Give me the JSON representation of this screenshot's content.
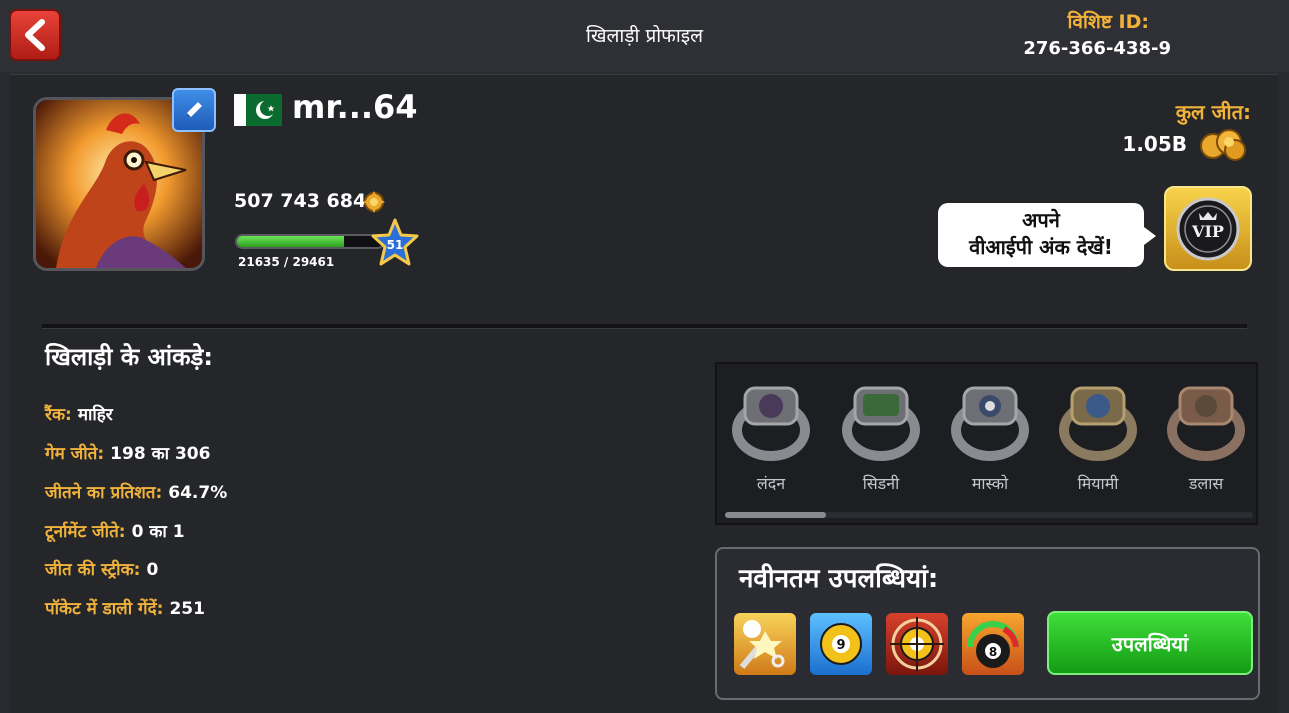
{
  "header": {
    "back_icon": "chevron-left-icon",
    "title": "खिलाड़ी प्रोफाइल",
    "unique_id_label": "विशिष्ट ID:",
    "unique_id_value": "276-366-438-9"
  },
  "profile": {
    "username": "mr...64",
    "flag": "pakistan-flag",
    "coins": "507 743 684",
    "xp_text": "21635 / 29461",
    "xp_fraction": 0.734,
    "level": "51",
    "total_wins_label": "कुल जीत:",
    "total_wins_value": "1.05B"
  },
  "vip": {
    "line1": "अपने",
    "line2": "वीआईपी अंक देखें!",
    "badge_text": "VIP"
  },
  "stats": {
    "title": "खिलाड़ी के आंकड़े:",
    "items": [
      {
        "label": "रैंक:",
        "value": "माहिर"
      },
      {
        "label": "गेम जीते:",
        "value": "198 का 306"
      },
      {
        "label": "जीतने का प्रतिशत:",
        "value": "64.7%"
      },
      {
        "label": "टूर्नामेंट जीते:",
        "value": "0 का 1"
      },
      {
        "label": "जीत की स्ट्रीक:",
        "value": "0"
      },
      {
        "label": "पॉकेट में डाली गेंदें:",
        "value": "251"
      }
    ]
  },
  "rings": [
    {
      "label": "लंदन"
    },
    {
      "label": "सिडनी"
    },
    {
      "label": "मास्को"
    },
    {
      "label": "मियामी"
    },
    {
      "label": "डलास"
    }
  ],
  "achievements": {
    "title": "नवीनतम उपलब्धियां:",
    "button_label": "उपलब्धियां",
    "icons": [
      "cue-ball-break-icon",
      "nine-ball-icon",
      "target-nine-ball-icon",
      "eight-ball-gauge-icon"
    ]
  },
  "colors": {
    "accent_gold": "#f0b23a",
    "button_green": "#2bc02a",
    "back_red": "#d9342b",
    "edit_blue": "#2f74d6"
  }
}
